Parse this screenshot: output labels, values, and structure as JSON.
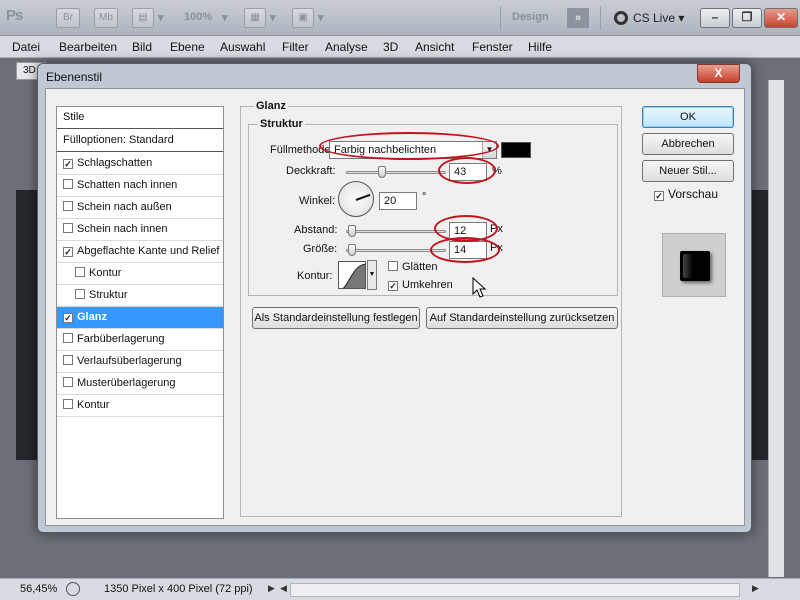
{
  "app": {
    "logo": "Ps",
    "bridge_label": "Br",
    "minibridge_label": "Mb",
    "zoom_value": "100%",
    "workspace_label": "Design",
    "cs_live_label": "CS Live"
  },
  "menu": [
    "Datei",
    "Bearbeiten",
    "Bild",
    "Ebene",
    "Auswahl",
    "Filter",
    "Analyse",
    "3D",
    "Ansicht",
    "Fenster",
    "Hilfe"
  ],
  "document": {
    "tab_label": "3D",
    "zoom_status": "56,45%",
    "doc_info": "1350 Pixel x 400 Pixel (72 ppi)"
  },
  "dialog": {
    "title": "Ebenenstil",
    "close_label": "X",
    "styles_list": [
      {
        "label": "Stile",
        "checkbox": false,
        "checked": false,
        "indent": false,
        "selected": false
      },
      {
        "label": "Fülloptionen: Standard",
        "checkbox": false,
        "checked": false,
        "indent": false,
        "selected": false
      },
      {
        "label": "Schlagschatten",
        "checkbox": true,
        "checked": true,
        "indent": false,
        "selected": false
      },
      {
        "label": "Schatten nach innen",
        "checkbox": true,
        "checked": false,
        "indent": false,
        "selected": false
      },
      {
        "label": "Schein nach außen",
        "checkbox": true,
        "checked": false,
        "indent": false,
        "selected": false
      },
      {
        "label": "Schein nach innen",
        "checkbox": true,
        "checked": false,
        "indent": false,
        "selected": false
      },
      {
        "label": "Abgeflachte Kante und Relief",
        "checkbox": true,
        "checked": true,
        "indent": false,
        "selected": false
      },
      {
        "label": "Kontur",
        "checkbox": true,
        "checked": false,
        "indent": true,
        "selected": false
      },
      {
        "label": "Struktur",
        "checkbox": true,
        "checked": false,
        "indent": true,
        "selected": false
      },
      {
        "label": "Glanz",
        "checkbox": true,
        "checked": true,
        "indent": false,
        "selected": true
      },
      {
        "label": "Farbüberlagerung",
        "checkbox": true,
        "checked": false,
        "indent": false,
        "selected": false
      },
      {
        "label": "Verlaufsüberlagerung",
        "checkbox": true,
        "checked": false,
        "indent": false,
        "selected": false
      },
      {
        "label": "Musterüberlagerung",
        "checkbox": true,
        "checked": false,
        "indent": false,
        "selected": false
      },
      {
        "label": "Kontur",
        "checkbox": true,
        "checked": false,
        "indent": false,
        "selected": false
      }
    ],
    "section_title": "Glanz",
    "subsection_title": "Struktur",
    "blend_mode_label": "Füllmethode:",
    "blend_mode_value": "Farbig nachbelichten",
    "opacity_label": "Deckkraft:",
    "opacity_value": "43",
    "opacity_unit": "%",
    "angle_label": "Winkel:",
    "angle_value": "20",
    "angle_unit": "°",
    "distance_label": "Abstand:",
    "distance_value": "12",
    "distance_unit": "Px",
    "size_label": "Größe:",
    "size_value": "14",
    "size_unit": "Px",
    "contour_label": "Kontur:",
    "smooth_label": "Glätten",
    "smooth_checked": false,
    "invert_label": "Umkehren",
    "invert_checked": true,
    "set_default_label": "Als Standardeinstellung festlegen",
    "reset_default_label": "Auf Standardeinstellung zurücksetzen",
    "ok_label": "OK",
    "cancel_label": "Abbrechen",
    "new_style_label": "Neuer Stil...",
    "preview_label": "Vorschau",
    "preview_checked": true
  },
  "colors": {
    "selection": "#3399ff",
    "gloss_color": "#000000",
    "annotation": "#c2141f"
  }
}
